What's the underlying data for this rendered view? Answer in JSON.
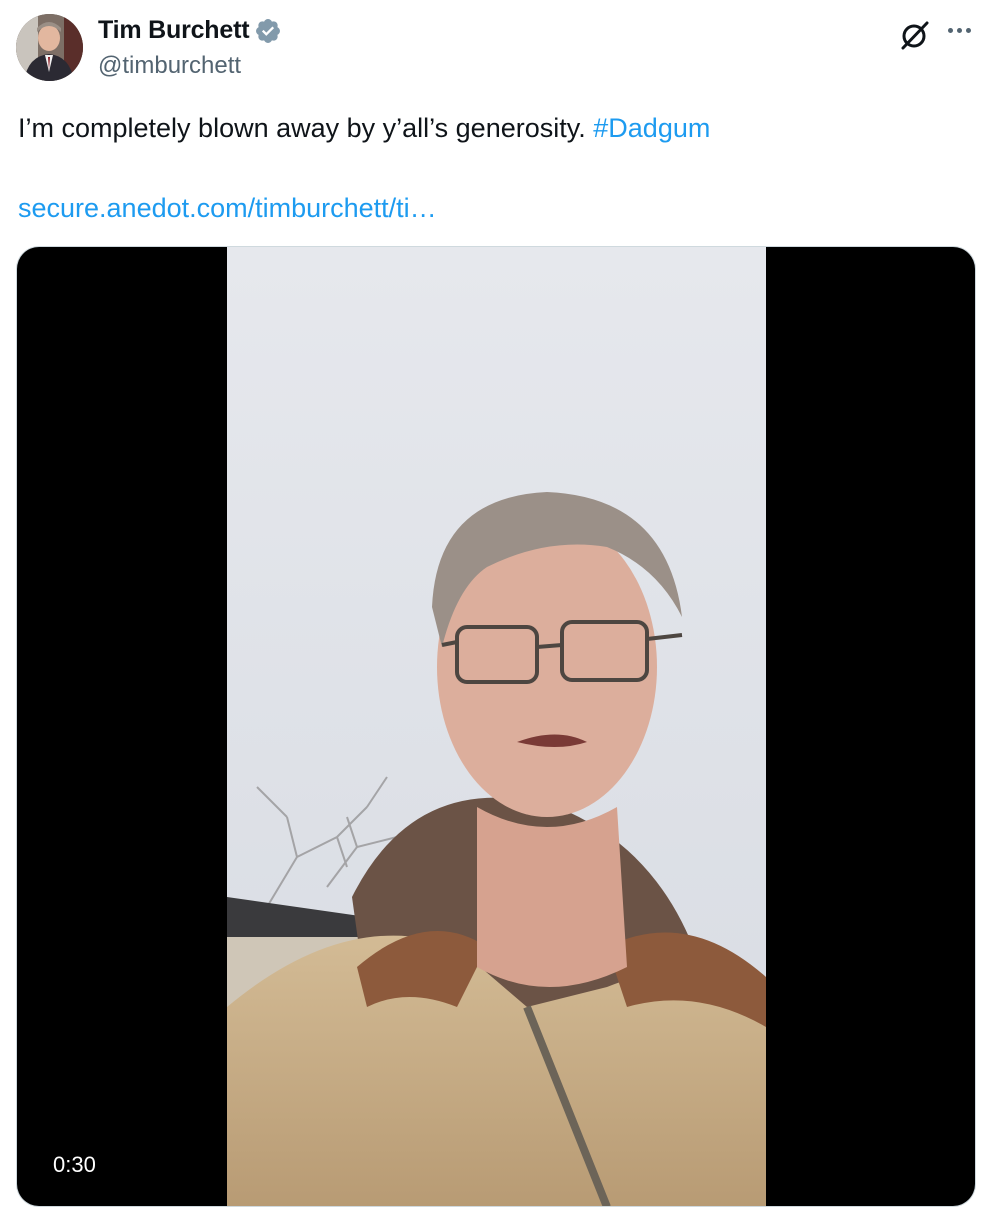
{
  "author": {
    "display_name": "Tim Burchett",
    "handle": "@timburchett",
    "verified": true,
    "verified_color": "#829aab"
  },
  "tweet": {
    "text": "I’m completely blown away by y’all’s generosity.",
    "hashtag": "#Dadgum",
    "link_text": "secure.anedot.com/timburchett/ti…"
  },
  "media": {
    "type": "video",
    "duration": "0:30"
  },
  "actions": {
    "grok_icon": "grok-icon",
    "more_icon": "more-options-icon"
  },
  "colors": {
    "link": "#1d9bf0",
    "text": "#0f1419",
    "secondary": "#536471"
  }
}
